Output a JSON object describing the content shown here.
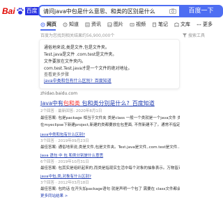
{
  "header": {
    "logo_part1": "Bai",
    "logo_part2": "百度",
    "query": "请问java中包是什么意思、和类的区别是什么",
    "search_button": "百度一下"
  },
  "tabs": [
    {
      "label": "网页",
      "icon": "web-icon"
    },
    {
      "label": "知道",
      "icon": "zhidao-icon"
    },
    {
      "label": "资讯",
      "icon": "news-icon"
    },
    {
      "label": "图片",
      "icon": "image-icon"
    },
    {
      "label": "视频",
      "icon": "video-icon"
    },
    {
      "label": "笔记",
      "icon": "note-icon"
    },
    {
      "label": "文库",
      "icon": "wenku-icon"
    },
    {
      "label": "更多",
      "icon": "more-icon"
    }
  ],
  "result_count": "百度为您找到相关结果约56,900,000个",
  "toolbox": "搜索工具",
  "answer": {
    "lines": [
      "通俗地来说,类是文件,包是文件夹。",
      "Test.java是文件 .com.test是文件夹。",
      "文件要放在文件夹内。",
      "com.test.Test.java才是一个文件的绝对地址。"
    ],
    "more": "查看更多步骤",
    "link": "java中类和包有什么区别?_百度知道"
  },
  "source": "zhidao.baidu.com",
  "results": [
    {
      "title_pre": "Java中有",
      "title_em": "包和类",
      "title_post": " 包和类分别是什么?_百度知道",
      "meta": "2个回答 · 最新回答: 2020年8月1日",
      "line1": "最佳答案: 包是package 相当于文件夹 类是class 一般一个类就是一个java文件 类都在包下面,",
      "line2": "在myeclipse下新建project,新建的类都要放在包里面, 不然新建不了。通常不指定...",
      "sub1": "java中类和包有什么区别?",
      "sub1_meta": "3个回答 · 2019年09月23日",
      "sub1_line": "最佳答案: 通俗地来说,类是文件,包是文件夹。Test.java是文件,.com.test是文件...",
      "sub2": "Java 语句 中 包 和类分别是什么意思",
      "sub2_meta": "6个回答 · 2019年10月31日",
      "sub2_line": "最佳答案: 包其实是组织起来的,而类是指现实生活中每个对象的抽象表示。万物皆对...",
      "sub3": "java中包,类,对象有什么区别?",
      "sub3_meta": "3个回答 · 2012年03月18日",
      "sub3_line": "最佳答案: 包的话 在开头加package语句 就是声明一个包了 需要在 class文件都会放...",
      "more": "更多同站结果 >"
    }
  ]
}
